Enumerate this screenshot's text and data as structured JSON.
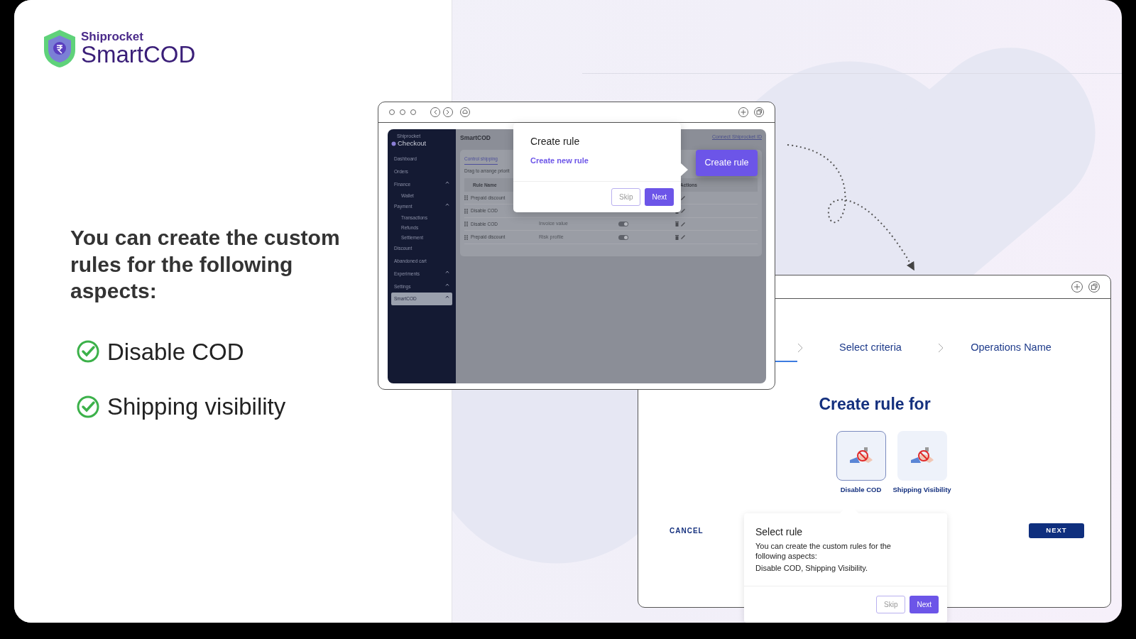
{
  "logo": {
    "brand": "Shiprocket",
    "product": "SmartCOD"
  },
  "headline": "You can create the custom rules for the following aspects:",
  "features": [
    {
      "label": "Disable COD",
      "checked": true
    },
    {
      "label": "Shipping visibility",
      "checked": true
    }
  ],
  "window_1": {
    "app": {
      "logo_small": "Shiprocket",
      "logo": "Checkout",
      "sidebar": [
        {
          "label": "Dashboard",
          "selected": false
        },
        {
          "label": "Orders",
          "selected": false
        },
        {
          "label": "Finance",
          "selected": false,
          "expanded": true,
          "children": [
            {
              "label": "Wallet"
            }
          ]
        },
        {
          "label": "Payment",
          "selected": false,
          "expanded": true,
          "children": [
            {
              "label": "Transactions"
            },
            {
              "label": "Refunds"
            },
            {
              "label": "Settlement"
            }
          ]
        },
        {
          "label": "Discount",
          "selected": false
        },
        {
          "label": "Abandoned cart",
          "selected": false
        },
        {
          "label": "Experiments",
          "selected": false,
          "expanded": true
        },
        {
          "label": "Settings",
          "selected": false,
          "expanded": true
        },
        {
          "label": "SmartCOD",
          "selected": true,
          "expanded": true
        }
      ],
      "page_title": "SmartCOD",
      "header_link": "Connect Shiprocket ID",
      "tab": "Control shipping",
      "hint": "Drag to arrange priorit",
      "columns": [
        "Rule Name",
        "Actions"
      ],
      "rows": [
        {
          "name": "Prepaid discount"
        },
        {
          "name": "Disable COD"
        },
        {
          "name": "Disable COD",
          "criteria": "Invoice value",
          "on": true
        },
        {
          "name": "Prepaid discount",
          "criteria": "Risk profile",
          "on": true
        }
      ]
    },
    "popover": {
      "title": "Create rule",
      "link": "Create new rule",
      "skip": "Skip",
      "next": "Next"
    },
    "highlighted_button": "Create rule"
  },
  "window_2": {
    "steps": [
      {
        "label": "Select criteria"
      },
      {
        "label": "Operations Name"
      }
    ],
    "title": "Create rule for",
    "options": [
      {
        "label": "Disable COD",
        "selected": true
      },
      {
        "label": "Shipping Visibility",
        "selected": false
      }
    ],
    "cancel": "CANCEL",
    "next": "NEXT",
    "popover": {
      "title": "Select rule",
      "body": [
        "You can create the custom rules for the following aspects:",
        "Disable COD, Shipping Visibility."
      ],
      "skip": "Skip",
      "next": "Next"
    }
  }
}
